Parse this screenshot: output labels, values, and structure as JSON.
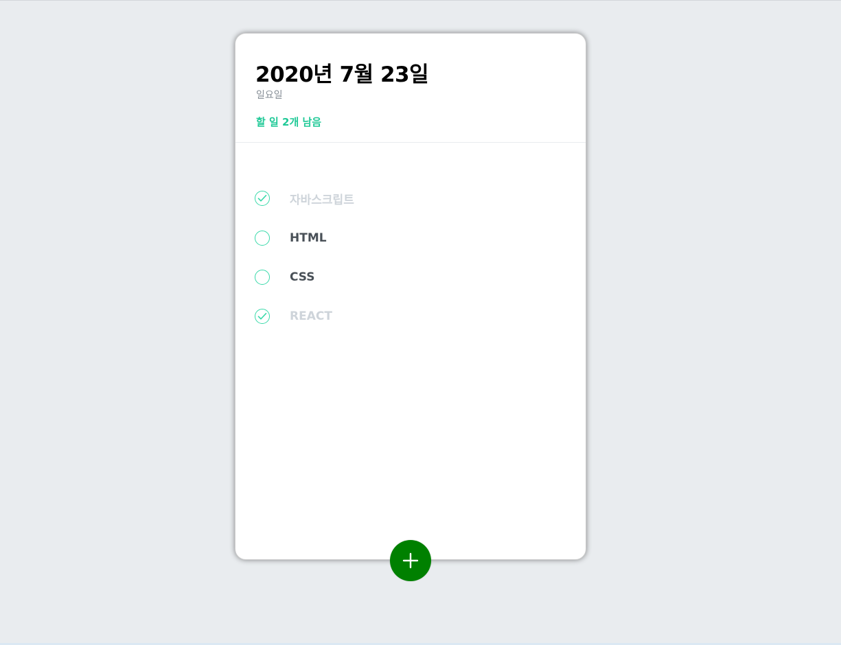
{
  "header": {
    "date": "2020년 7월 23일",
    "weekday": "일요일",
    "tasks_left": "할 일 2개 남음"
  },
  "todos": [
    {
      "text": "자바스크립트",
      "done": true
    },
    {
      "text": "HTML",
      "done": false
    },
    {
      "text": "CSS",
      "done": false
    },
    {
      "text": "REACT",
      "done": true
    }
  ],
  "add_button": {
    "icon": "plus-icon"
  },
  "colors": {
    "background": "#e9ecef",
    "card": "#ffffff",
    "accent": "#20c997",
    "check_border": "#38d9a9",
    "add_button": "#008000",
    "done_text": "#ced4da",
    "active_text": "#495057"
  }
}
